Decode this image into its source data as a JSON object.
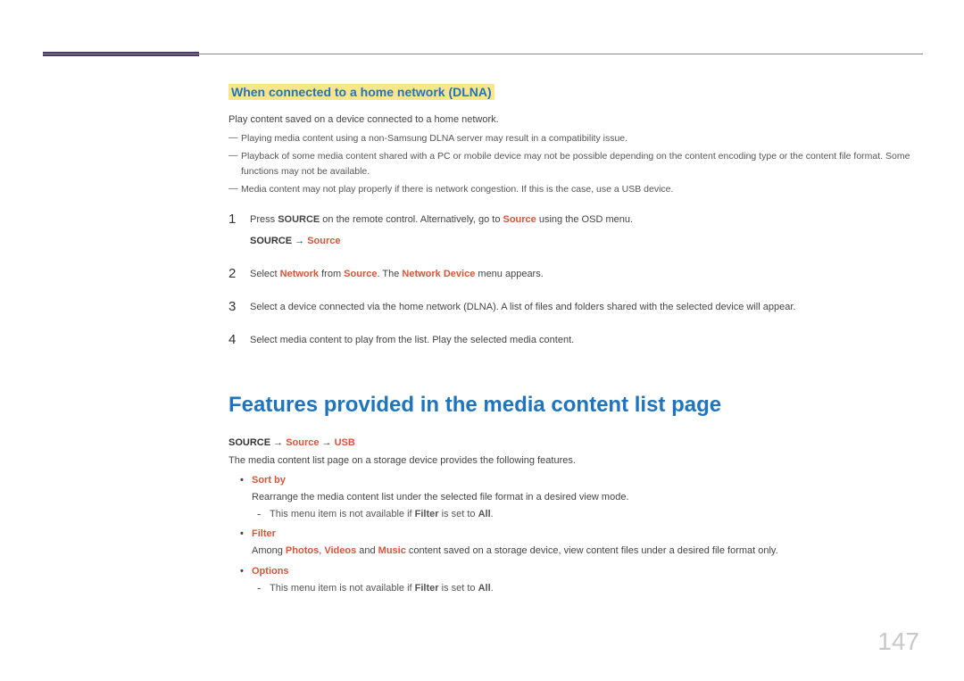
{
  "section1": {
    "title": "When connected to a home network (DLNA)",
    "intro": "Play content saved on a device connected to a home network.",
    "notes": [
      "Playing media content using a non-Samsung DLNA server may result in a compatibility issue.",
      "Playback of some media content shared with a PC or mobile device may not be possible depending on the content encoding type or the content file format. Some functions may not be available.",
      "Media content may not play properly if there is network congestion. If this is the case, use a USB device."
    ],
    "steps": {
      "s1_a": "Press ",
      "s1_b": "SOURCE",
      "s1_c": " on the remote control. Alternatively, go to ",
      "s1_d": "Source",
      "s1_e": " using the OSD menu.",
      "s1_path_a": "SOURCE",
      "s1_path_arrow": " → ",
      "s1_path_b": "Source",
      "s2_a": "Select ",
      "s2_b": "Network",
      "s2_c": " from ",
      "s2_d": "Source",
      "s2_e": ". The ",
      "s2_f": "Network Device",
      "s2_g": " menu appears.",
      "s3": "Select a device connected via the home network (DLNA). A list of files and folders shared with the selected device will appear.",
      "s4": "Select media content to play from the list. Play the selected media content."
    }
  },
  "section2": {
    "heading": "Features provided in the media content list page",
    "path_a": "SOURCE",
    "path_arrow1": " → ",
    "path_b": "Source",
    "path_arrow2": " → ",
    "path_c": "USB",
    "intro": "The media content list page on a storage device provides the following features.",
    "bullets": {
      "b1_title": "Sort by",
      "b1_desc": "Rearrange the media content list under the selected file format in a desired view mode.",
      "b1_note_a": "This menu item is not available if ",
      "b1_note_b": "Filter",
      "b1_note_c": " is set to ",
      "b1_note_d": "All",
      "b1_note_e": ".",
      "b2_title": "Filter",
      "b2_desc_a": "Among ",
      "b2_desc_b": "Photos",
      "b2_desc_c": ", ",
      "b2_desc_d": "Videos",
      "b2_desc_e": " and ",
      "b2_desc_f": "Music",
      "b2_desc_g": " content saved on a storage device, view content files under a desired file format only.",
      "b3_title": "Options",
      "b3_note_a": "This menu item is not available if ",
      "b3_note_b": "Filter",
      "b3_note_c": " is set to ",
      "b3_note_d": "All",
      "b3_note_e": "."
    }
  },
  "page_number": "147"
}
